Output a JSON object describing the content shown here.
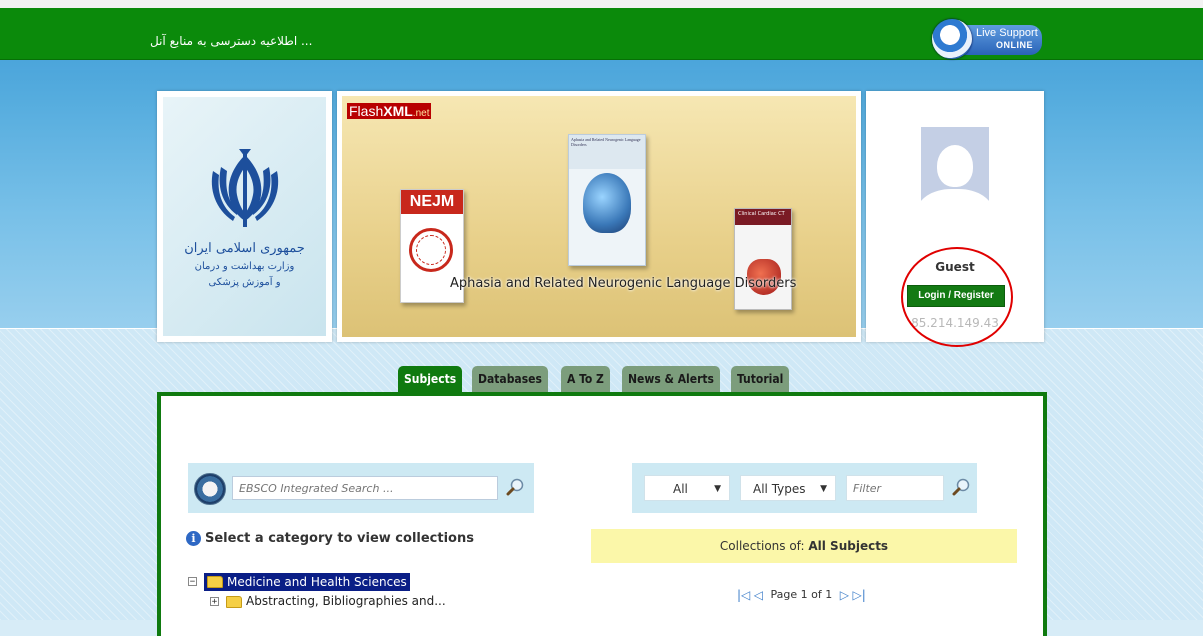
{
  "header": {
    "notice_text": "... اطلاعیه دسترسی به منابع آنل",
    "live_support": {
      "line1": "Live Support",
      "line2": "ONLINE",
      "icon": "headset-icon"
    }
  },
  "emblem": {
    "line1": "جمهوری اسلامی ایران",
    "line2": "وزارت بهداشت و درمان",
    "line3": "و آموزش پزشکی"
  },
  "slider": {
    "brand": "FlashXML.net",
    "caption": "Aphasia and Related Neurogenic Language Disorders",
    "books": [
      {
        "title": "NEJM"
      },
      {
        "title": "Aphasia and Related Neurogenic Language Disorders"
      },
      {
        "title": "Clinical Cardiac CT"
      }
    ]
  },
  "profile": {
    "name": "Guest",
    "login_label": "Login / Register",
    "ip": "85.214.149.43"
  },
  "tabs": [
    {
      "label": "Subjects",
      "active": true
    },
    {
      "label": "Databases",
      "active": false
    },
    {
      "label": "A To Z",
      "active": false
    },
    {
      "label": "News & Alerts",
      "active": false
    },
    {
      "label": "Tutorial",
      "active": false
    }
  ],
  "search": {
    "placeholder": "EBSCO Integrated Search ...",
    "logo_icon": "ebsco-logo-icon",
    "button_icon": "magnifier-icon"
  },
  "category_prompt": "Select a category to view collections",
  "tree": [
    {
      "label": "Medicine and Health Sciences",
      "toggle": "−",
      "selected": true
    },
    {
      "label": "Abstracting, Bibliographies and...",
      "toggle": "+",
      "selected": false
    }
  ],
  "filters": {
    "scope_value": "All",
    "type_value": "All Types",
    "filter_placeholder": "Filter"
  },
  "collections": {
    "prefix": "Collections of:",
    "subject": "All Subjects"
  },
  "pager": {
    "text": "Page 1 of 1"
  },
  "colors": {
    "header_green": "#0b8a0b",
    "tab_active": "#0f7a0f",
    "tab_inactive": "#7c9d7c",
    "highlight_yellow": "#fbf7a9",
    "selection_blue": "#0a1e86"
  }
}
